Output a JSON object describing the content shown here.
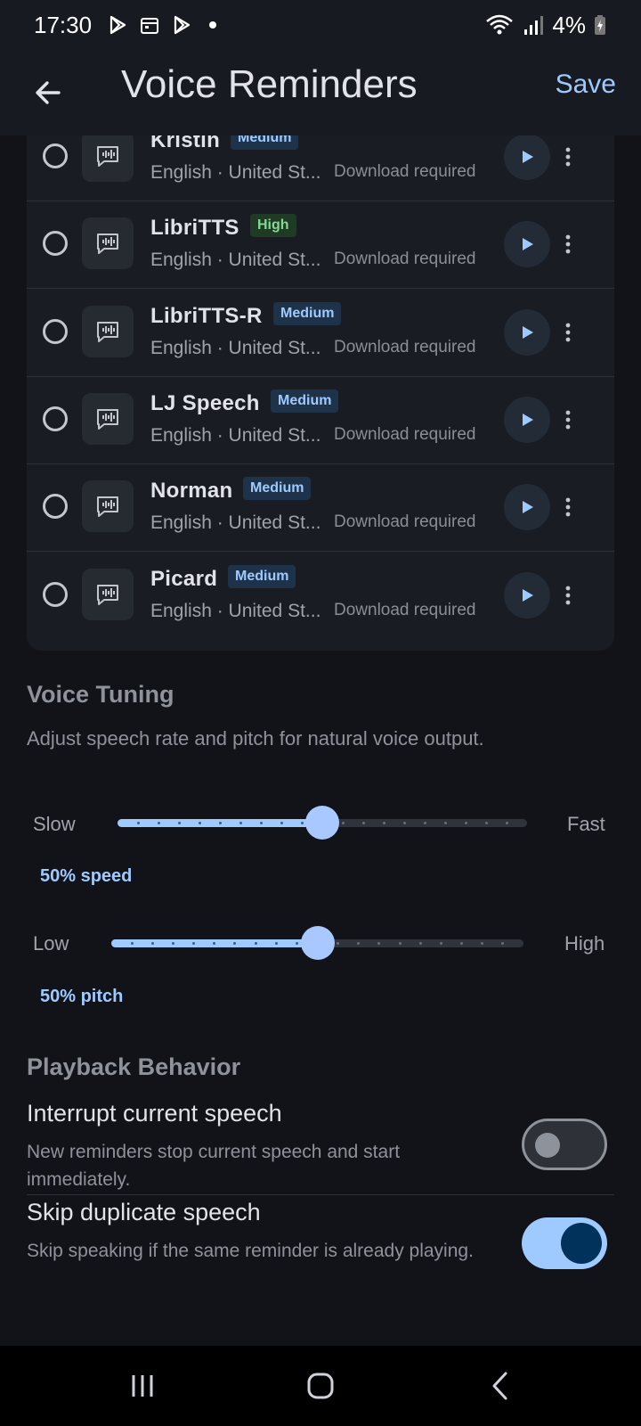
{
  "status_bar": {
    "time": "17:30",
    "battery": "4%"
  },
  "app_bar": {
    "title": "Voice Reminders",
    "save_label": "Save"
  },
  "voices": [
    {
      "name": "Kristin",
      "quality": "Medium",
      "language": "English · United St...",
      "status": "Download required"
    },
    {
      "name": "LibriTTS",
      "quality": "High",
      "language": "English · United St...",
      "status": "Download required"
    },
    {
      "name": "LibriTTS-R",
      "quality": "Medium",
      "language": "English · United St...",
      "status": "Download required"
    },
    {
      "name": "LJ Speech",
      "quality": "Medium",
      "language": "English · United St...",
      "status": "Download required"
    },
    {
      "name": "Norman",
      "quality": "Medium",
      "language": "English · United St...",
      "status": "Download required"
    },
    {
      "name": "Picard",
      "quality": "Medium",
      "language": "English · United St...",
      "status": "Download required"
    }
  ],
  "voice_tuning": {
    "title": "Voice Tuning",
    "description": "Adjust speech rate and pitch for natural voice output.",
    "speed": {
      "min_label": "Slow",
      "max_label": "Fast",
      "value": 0.5,
      "value_text": "50% speed"
    },
    "pitch": {
      "min_label": "Low",
      "max_label": "High",
      "value": 0.5,
      "value_text": "50% pitch"
    }
  },
  "playback": {
    "title": "Playback Behavior",
    "interrupt": {
      "title": "Interrupt current speech",
      "description": "New reminders stop current speech and start immediately.",
      "enabled": false
    },
    "skip_duplicate": {
      "title": "Skip duplicate speech",
      "description": "Skip speaking if the same reminder is already playing.",
      "enabled": true
    }
  },
  "colors": {
    "accent": "#9ecaff",
    "background": "#111318",
    "badge_high_text": "#86d993"
  }
}
